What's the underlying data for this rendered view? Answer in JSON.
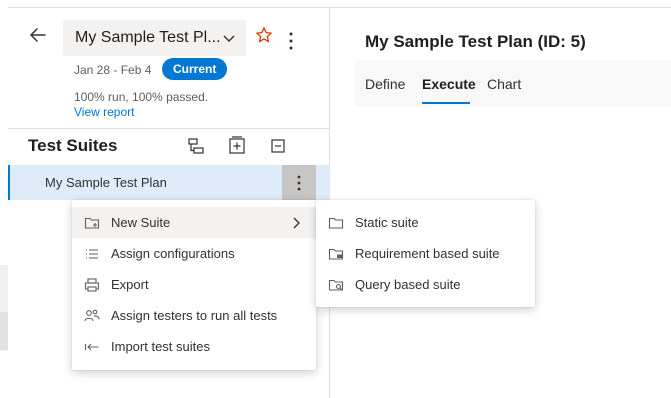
{
  "colors": {
    "accent": "#0078d4",
    "selected_row": "#deecf9",
    "favorite_star": "#d83b01"
  },
  "header": {
    "plan_picker_label": "My Sample Test Pl...",
    "date_range": "Jan 28 - Feb 4",
    "status_badge": "Current",
    "run_stats": "100% run, 100% passed.",
    "view_report_link": "View report",
    "icons": [
      "back-arrow-icon",
      "chevron-down-icon",
      "star-icon",
      "more-vertical-icon"
    ]
  },
  "suites": {
    "title": "Test Suites",
    "tool_icons": [
      "expand-tree-icon",
      "expand-all-icon",
      "collapse-all-icon"
    ],
    "selected_suite": "My Sample Test Plan"
  },
  "context_menu": {
    "items": [
      {
        "label": "New Suite",
        "icon": "new-suite-icon",
        "has_submenu": true
      },
      {
        "label": "Assign configurations",
        "icon": "list-icon"
      },
      {
        "label": "Export",
        "icon": "print-icon"
      },
      {
        "label": "Assign testers to run all tests",
        "icon": "people-icon"
      },
      {
        "label": "Import test suites",
        "icon": "import-icon"
      }
    ]
  },
  "submenu": {
    "items": [
      {
        "label": "Static suite",
        "icon": "folder-icon"
      },
      {
        "label": "Requirement based suite",
        "icon": "requirement-suite-icon"
      },
      {
        "label": "Query based suite",
        "icon": "query-suite-icon"
      }
    ]
  },
  "main": {
    "plan_title": "My Sample Test Plan (ID: 5)",
    "tabs": [
      {
        "label": "Define",
        "active": false
      },
      {
        "label": "Execute",
        "active": true
      },
      {
        "label": "Chart",
        "active": false
      }
    ]
  }
}
